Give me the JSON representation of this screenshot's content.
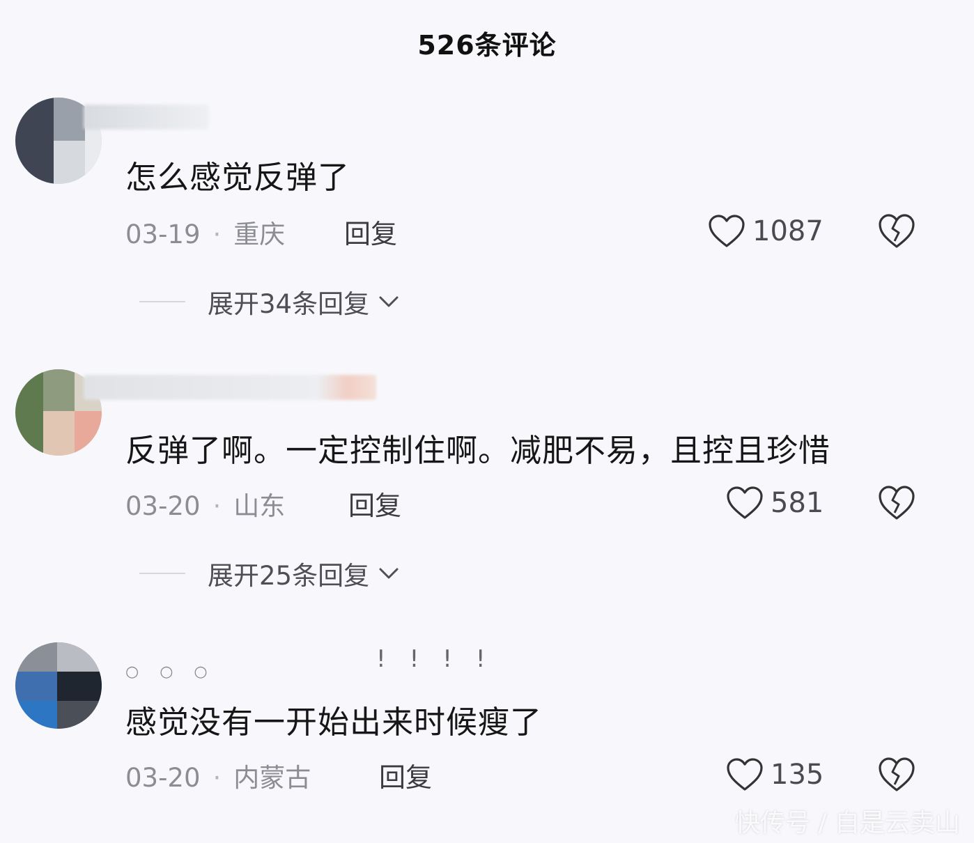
{
  "header": {
    "title": "526条评论"
  },
  "comments": [
    {
      "text": "怎么感觉反弹了",
      "date": "03-19",
      "location": "重庆",
      "reply_label": "回复",
      "likes": "1087",
      "expand_label": "展开34条回复"
    },
    {
      "text": "反弹了啊。一定控制住啊。减肥不易，且控且珍惜",
      "date": "03-20",
      "location": "山东",
      "reply_label": "回复",
      "likes": "581",
      "expand_label": "展开25条回复"
    },
    {
      "text": "感觉没有一开始出来时候瘦了",
      "date": "03-20",
      "location": "内蒙古",
      "reply_label": "回复",
      "likes": "135"
    }
  ],
  "decor": {
    "separator": "·",
    "marks": "!!!!"
  },
  "watermark": "快传号 / 自是云卖山",
  "icons": {
    "like": "heart-outline-icon",
    "dislike": "broken-heart-icon",
    "expand": "chevron-down-icon"
  },
  "colors": {
    "background": "#f8f8fc",
    "text": "#161616",
    "meta": "#8c8c93"
  }
}
